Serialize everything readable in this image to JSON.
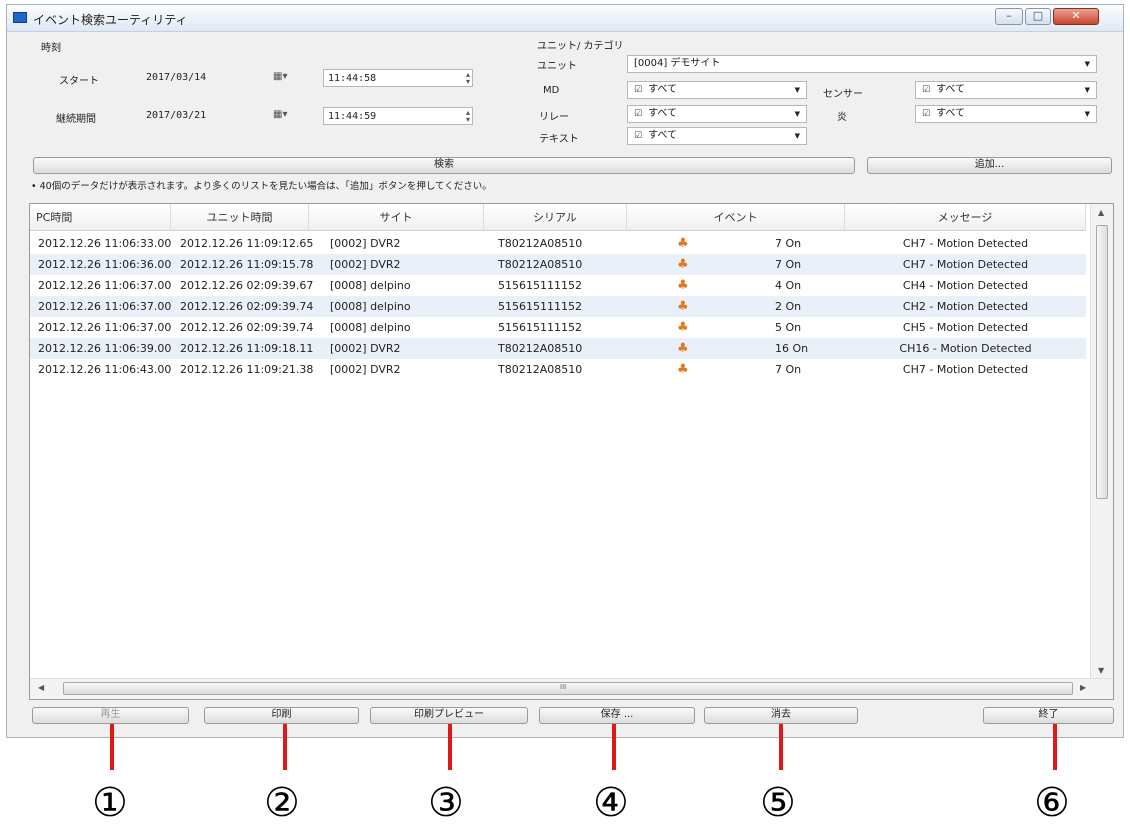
{
  "window": {
    "title": "イベント検索ユーティリティ"
  },
  "time_section": {
    "label": "時刻",
    "start_label": "スタート",
    "start_date": "2017/03/14",
    "start_time": "11:44:58",
    "end_label": "継続期間",
    "end_date": "2017/03/21",
    "end_time": "11:44:59"
  },
  "unit_section": {
    "label": "ユニット/ カテゴリ",
    "unit_label": "ユニット",
    "unit_value": "[0004] デモサイト",
    "md_label": "MD",
    "md_value": "すべて",
    "sensor_label": "センサー",
    "sensor_value": "すべて",
    "relay_label": "リレー",
    "relay_value": "すべて",
    "fire_label": "炎",
    "fire_value": "すべて",
    "text_label": "テキスト",
    "text_value": "すべて"
  },
  "search_button": "検索",
  "add_button": "追加...",
  "info_text": "• 40個のデータだけが表示されます。より多くのリストを見たい場合は、「追加」ボタンを押してください。",
  "table": {
    "headers": [
      "PC時間",
      "ユニット時間",
      "サイト",
      "シリアル",
      "イベント",
      "メッセージ"
    ],
    "rows": [
      [
        "2012.12.26 11:06:33.00",
        "2012.12.26 11:09:12.65",
        "[0002] DVR2",
        "T80212A08510",
        "7 On",
        "CH7 - Motion Detected"
      ],
      [
        "2012.12.26 11:06:36.00",
        "2012.12.26 11:09:15.78",
        "[0002] DVR2",
        "T80212A08510",
        "7 On",
        "CH7 - Motion Detected"
      ],
      [
        "2012.12.26 11:06:37.00",
        "2012.12.26 02:09:39.67",
        "[0008] delpino",
        "515615111152",
        "4 On",
        "CH4 - Motion Detected"
      ],
      [
        "2012.12.26 11:06:37.00",
        "2012.12.26 02:09:39.74",
        "[0008] delpino",
        "515615111152",
        "2 On",
        "CH2 - Motion Detected"
      ],
      [
        "2012.12.26 11:06:37.00",
        "2012.12.26 02:09:39.74",
        "[0008] delpino",
        "515615111152",
        "5 On",
        "CH5 - Motion Detected"
      ],
      [
        "2012.12.26 11:06:39.00",
        "2012.12.26 11:09:18.11",
        "[0002] DVR2",
        "T80212A08510",
        "16 On",
        "CH16 - Motion Detected"
      ],
      [
        "2012.12.26 11:06:43.00",
        "2012.12.26 11:09:21.38",
        "[0002] DVR2",
        "T80212A08510",
        "7 On",
        "CH7 - Motion Detected"
      ]
    ]
  },
  "hscroll_mark": "III",
  "buttons": {
    "play": "再生",
    "print": "印刷",
    "print_preview": "印刷プレビュー",
    "save": "保存 ...",
    "clear": "消去",
    "exit": "終了"
  },
  "callouts": [
    "①",
    "②",
    "③",
    "④",
    "⑤",
    "⑥"
  ],
  "colors": {
    "callout_line": "#e01818",
    "row_alt": "#eaf0fa",
    "event_icon": "#e07a1f"
  },
  "icons": {
    "event": "motion-person-icon",
    "calendar": "calendar-dropdown-icon",
    "spin": "spin-buttons-icon"
  }
}
